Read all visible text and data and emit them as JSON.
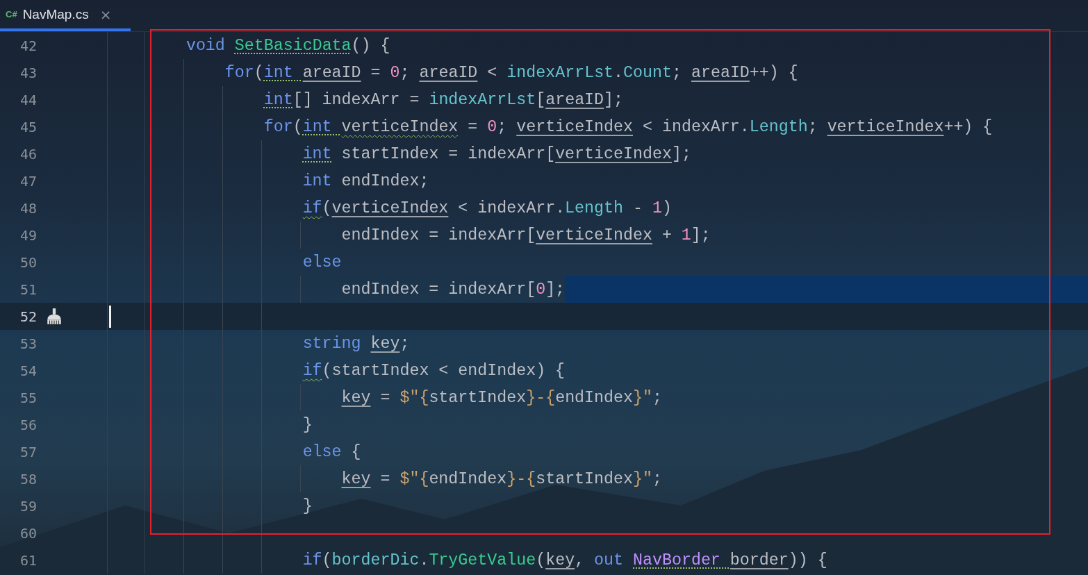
{
  "tabs": [
    {
      "lang": "C#",
      "label": "NavMap.cs",
      "close": "×",
      "selected": true
    }
  ],
  "lines": [
    {
      "number": "42",
      "current": false,
      "selected": false,
      "tokens": [
        {
          "kind": "kw",
          "text": "void "
        },
        {
          "kind": "fn",
          "text": "SetBasicData",
          "dotted_hint": true
        },
        {
          "kind": "plain",
          "text": "() {"
        }
      ],
      "children": [
        {
          "number": "43",
          "current": false,
          "selected": false,
          "tokens": [
            {
              "kind": "kw",
              "text": "for"
            },
            {
              "kind": "plain",
              "text": "("
            },
            {
              "kind": "kw",
              "text": "int ",
              "dotted_hint": true
            },
            {
              "kind": "local",
              "text": "areaID"
            },
            {
              "kind": "plain",
              "text": " = "
            },
            {
              "kind": "num",
              "text": "0"
            },
            {
              "kind": "plain",
              "text": "; "
            },
            {
              "kind": "local",
              "text": "areaID"
            },
            {
              "kind": "plain",
              "text": " < "
            },
            {
              "kind": "member",
              "text": "indexArrLst"
            },
            {
              "kind": "plain",
              "text": "."
            },
            {
              "kind": "member",
              "text": "Count"
            },
            {
              "kind": "plain",
              "text": "; "
            },
            {
              "kind": "local",
              "text": "areaID"
            },
            {
              "kind": "plain",
              "text": "++) {"
            }
          ],
          "children": [
            {
              "number": "44",
              "current": false,
              "selected": false,
              "tokens": [
                {
                  "kind": "kw",
                  "text": "int",
                  "dotted_hint": true
                },
                {
                  "kind": "plain",
                  "text": "[] indexArr = "
                },
                {
                  "kind": "member",
                  "text": "indexArrLst"
                },
                {
                  "kind": "plain",
                  "text": "["
                },
                {
                  "kind": "local",
                  "text": "areaID"
                },
                {
                  "kind": "plain",
                  "text": "];"
                }
              ]
            },
            {
              "number": "45",
              "current": false,
              "selected": false,
              "tokens": [
                {
                  "kind": "kw",
                  "text": "for"
                },
                {
                  "kind": "plain",
                  "text": "("
                },
                {
                  "kind": "kw",
                  "text": "int ",
                  "dotted_hint": true
                },
                {
                  "kind": "local",
                  "text": "verticeIndex",
                  "wavy_hint": true
                },
                {
                  "kind": "plain",
                  "text": " = "
                },
                {
                  "kind": "num",
                  "text": "0"
                },
                {
                  "kind": "plain",
                  "text": "; "
                },
                {
                  "kind": "local",
                  "text": "verticeIndex"
                },
                {
                  "kind": "plain",
                  "text": " < indexArr."
                },
                {
                  "kind": "member",
                  "text": "Length"
                },
                {
                  "kind": "plain",
                  "text": "; "
                },
                {
                  "kind": "local",
                  "text": "verticeIndex"
                },
                {
                  "kind": "plain",
                  "text": "++) {"
                }
              ],
              "children": [
                {
                  "number": "46",
                  "current": false,
                  "selected": false,
                  "tokens": [
                    {
                      "kind": "kw",
                      "text": "int",
                      "dotted_hint": true
                    },
                    {
                      "kind": "plain",
                      "text": " startIndex = indexArr["
                    },
                    {
                      "kind": "local",
                      "text": "verticeIndex"
                    },
                    {
                      "kind": "plain",
                      "text": "];"
                    }
                  ]
                },
                {
                  "number": "47",
                  "current": false,
                  "selected": false,
                  "tokens": [
                    {
                      "kind": "kw",
                      "text": "int"
                    },
                    {
                      "kind": "plain",
                      "text": " endIndex;"
                    }
                  ]
                },
                {
                  "number": "48",
                  "current": false,
                  "selected": false,
                  "tokens": [
                    {
                      "kind": "kw",
                      "text": "if",
                      "wavy_hint": true
                    },
                    {
                      "kind": "plain",
                      "text": "("
                    },
                    {
                      "kind": "local",
                      "text": "verticeIndex"
                    },
                    {
                      "kind": "plain",
                      "text": " < indexArr."
                    },
                    {
                      "kind": "member",
                      "text": "Length"
                    },
                    {
                      "kind": "plain",
                      "text": " - "
                    },
                    {
                      "kind": "num",
                      "text": "1"
                    },
                    {
                      "kind": "plain",
                      "text": ")"
                    }
                  ],
                  "children": [
                    {
                      "number": "49",
                      "current": false,
                      "selected": false,
                      "tokens": [
                        {
                          "kind": "plain",
                          "text": "endIndex = indexArr["
                        },
                        {
                          "kind": "local",
                          "text": "verticeIndex"
                        },
                        {
                          "kind": "plain",
                          "text": " + "
                        },
                        {
                          "kind": "num",
                          "text": "1"
                        },
                        {
                          "kind": "plain",
                          "text": "];"
                        }
                      ]
                    }
                  ]
                },
                {
                  "number": "50",
                  "current": false,
                  "selected": false,
                  "tokens": [
                    {
                      "kind": "kw",
                      "text": "else"
                    }
                  ],
                  "children": [
                    {
                      "number": "51",
                      "current": false,
                      "selected": true,
                      "tokens": [
                        {
                          "kind": "plain",
                          "text": "endIndex = indexArr["
                        },
                        {
                          "kind": "num",
                          "text": "0"
                        },
                        {
                          "kind": "plain",
                          "text": "];"
                        }
                      ]
                    }
                  ]
                },
                {
                  "number": "52",
                  "current": true,
                  "selected": false
                },
                {
                  "number": "53",
                  "current": false,
                  "selected": false,
                  "tokens": [
                    {
                      "kind": "kw",
                      "text": "string "
                    },
                    {
                      "kind": "local",
                      "text": "key"
                    },
                    {
                      "kind": "plain",
                      "text": ";"
                    }
                  ]
                },
                {
                  "number": "54",
                  "current": false,
                  "selected": false,
                  "tokens": [
                    {
                      "kind": "kw",
                      "text": "if",
                      "wavy_hint": true
                    },
                    {
                      "kind": "plain",
                      "text": "(startIndex < endIndex) {"
                    }
                  ],
                  "children": [
                    {
                      "number": "55",
                      "current": false,
                      "selected": false,
                      "tokens": [
                        {
                          "kind": "local",
                          "text": "key"
                        },
                        {
                          "kind": "plain",
                          "text": " = "
                        },
                        {
                          "kind": "str",
                          "text": "$\"{"
                        },
                        {
                          "kind": "plain",
                          "text": "startIndex"
                        },
                        {
                          "kind": "str",
                          "text": "}-{"
                        },
                        {
                          "kind": "plain",
                          "text": "endIndex"
                        },
                        {
                          "kind": "str",
                          "text": "}\""
                        },
                        {
                          "kind": "plain",
                          "text": ";"
                        }
                      ]
                    }
                  ]
                },
                {
                  "number": "56",
                  "current": false,
                  "selected": false,
                  "tokens": [
                    {
                      "kind": "plain",
                      "text": "}"
                    }
                  ]
                },
                {
                  "number": "57",
                  "current": false,
                  "selected": false,
                  "tokens": [
                    {
                      "kind": "kw",
                      "text": "else"
                    },
                    {
                      "kind": "plain",
                      "text": " {"
                    }
                  ],
                  "children": [
                    {
                      "number": "58",
                      "current": false,
                      "selected": false,
                      "tokens": [
                        {
                          "kind": "local",
                          "text": "key"
                        },
                        {
                          "kind": "plain",
                          "text": " = "
                        },
                        {
                          "kind": "str",
                          "text": "$\"{"
                        },
                        {
                          "kind": "plain",
                          "text": "endIndex"
                        },
                        {
                          "kind": "str",
                          "text": "}-{"
                        },
                        {
                          "kind": "plain",
                          "text": "startIndex"
                        },
                        {
                          "kind": "str",
                          "text": "}\""
                        },
                        {
                          "kind": "plain",
                          "text": ";"
                        }
                      ]
                    }
                  ]
                },
                {
                  "number": "59",
                  "current": false,
                  "selected": false,
                  "tokens": [
                    {
                      "kind": "plain",
                      "text": "}"
                    }
                  ]
                },
                {
                  "number": "60",
                  "current": false,
                  "selected": false
                },
                {
                  "number": "61",
                  "current": false,
                  "selected": false,
                  "tokens": [
                    {
                      "kind": "kw",
                      "text": "if"
                    },
                    {
                      "kind": "plain",
                      "text": "("
                    },
                    {
                      "kind": "member",
                      "text": "borderDic"
                    },
                    {
                      "kind": "plain",
                      "text": "."
                    },
                    {
                      "kind": "fn",
                      "text": "TryGetValue"
                    },
                    {
                      "kind": "plain",
                      "text": "("
                    },
                    {
                      "kind": "local",
                      "text": "key"
                    },
                    {
                      "kind": "plain",
                      "text": ", "
                    },
                    {
                      "kind": "kw",
                      "text": "out "
                    },
                    {
                      "kind": "type",
                      "text": "NavBorder ",
                      "dotted_hint": true
                    },
                    {
                      "kind": "local",
                      "text": "border"
                    },
                    {
                      "kind": "plain",
                      "text": ")) {"
                    }
                  ]
                }
              ]
            }
          ]
        }
      ]
    }
  ],
  "annotation": {
    "kind": "frame"
  }
}
